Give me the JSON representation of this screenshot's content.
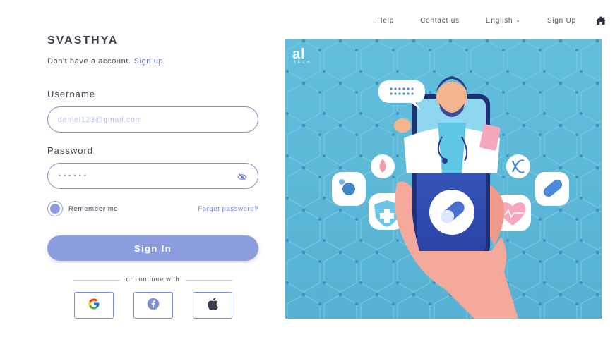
{
  "nav": {
    "help": "Help",
    "contact": "Contact us",
    "language": "English",
    "signup": "Sign Up",
    "home_icon": "home-icon"
  },
  "brand": "SVASTHYA",
  "account": {
    "prompt": "Don't have a account.",
    "link": "Sign up"
  },
  "form": {
    "username_label": "Username",
    "username_placeholder": "deniel123@gmail.com",
    "password_label": "Password",
    "password_mask": "••••••",
    "remember_label": "Remember me",
    "remember_checked": true,
    "forgot_label": "Forget password?",
    "signin_label": "Sign In"
  },
  "social": {
    "divider_text": "or continue with",
    "providers": [
      "google-icon",
      "facebook-icon",
      "apple-icon"
    ]
  },
  "hero": {
    "logo_text": "al",
    "logo_sub": "TECH"
  },
  "colors": {
    "accent": "#7d8fd9",
    "button": "#8b9ddf",
    "link": "#5a6fce",
    "hero_bg": "#5fb8d6"
  }
}
